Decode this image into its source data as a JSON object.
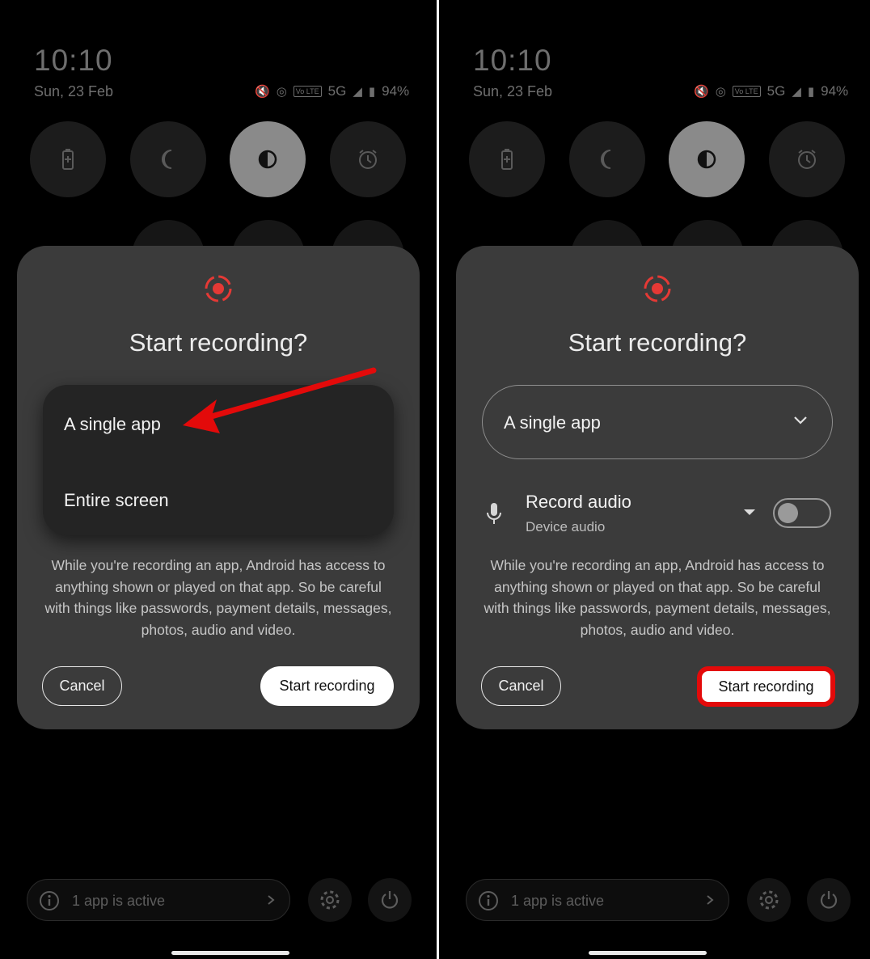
{
  "status_bar": {
    "time": "10:10",
    "date": "Sun, 23 Feb",
    "network": "5G",
    "volte": "Vo LTE",
    "battery": "94%"
  },
  "quick_tiles": [
    "battery-saver-icon",
    "night-mode-icon",
    "dark-mode-icon",
    "alarm-icon"
  ],
  "dialog": {
    "title": "Start recording?",
    "options": [
      "A single app",
      "Entire screen"
    ],
    "selected_option": "A single app",
    "record_audio": {
      "title": "Record audio",
      "source": "Device audio",
      "enabled": false
    },
    "warning": "While you're recording an app, Android has access to anything shown or played on that app. So be careful with things like passwords, payment details, messages, photos, audio and video.",
    "cancel_label": "Cancel",
    "start_label": "Start recording"
  },
  "footer": {
    "active_apps": "1 app is active"
  },
  "colors": {
    "accent_red": "#e53935",
    "annotation_red": "#e30a0a",
    "dialog_bg": "#3b3b3b"
  }
}
